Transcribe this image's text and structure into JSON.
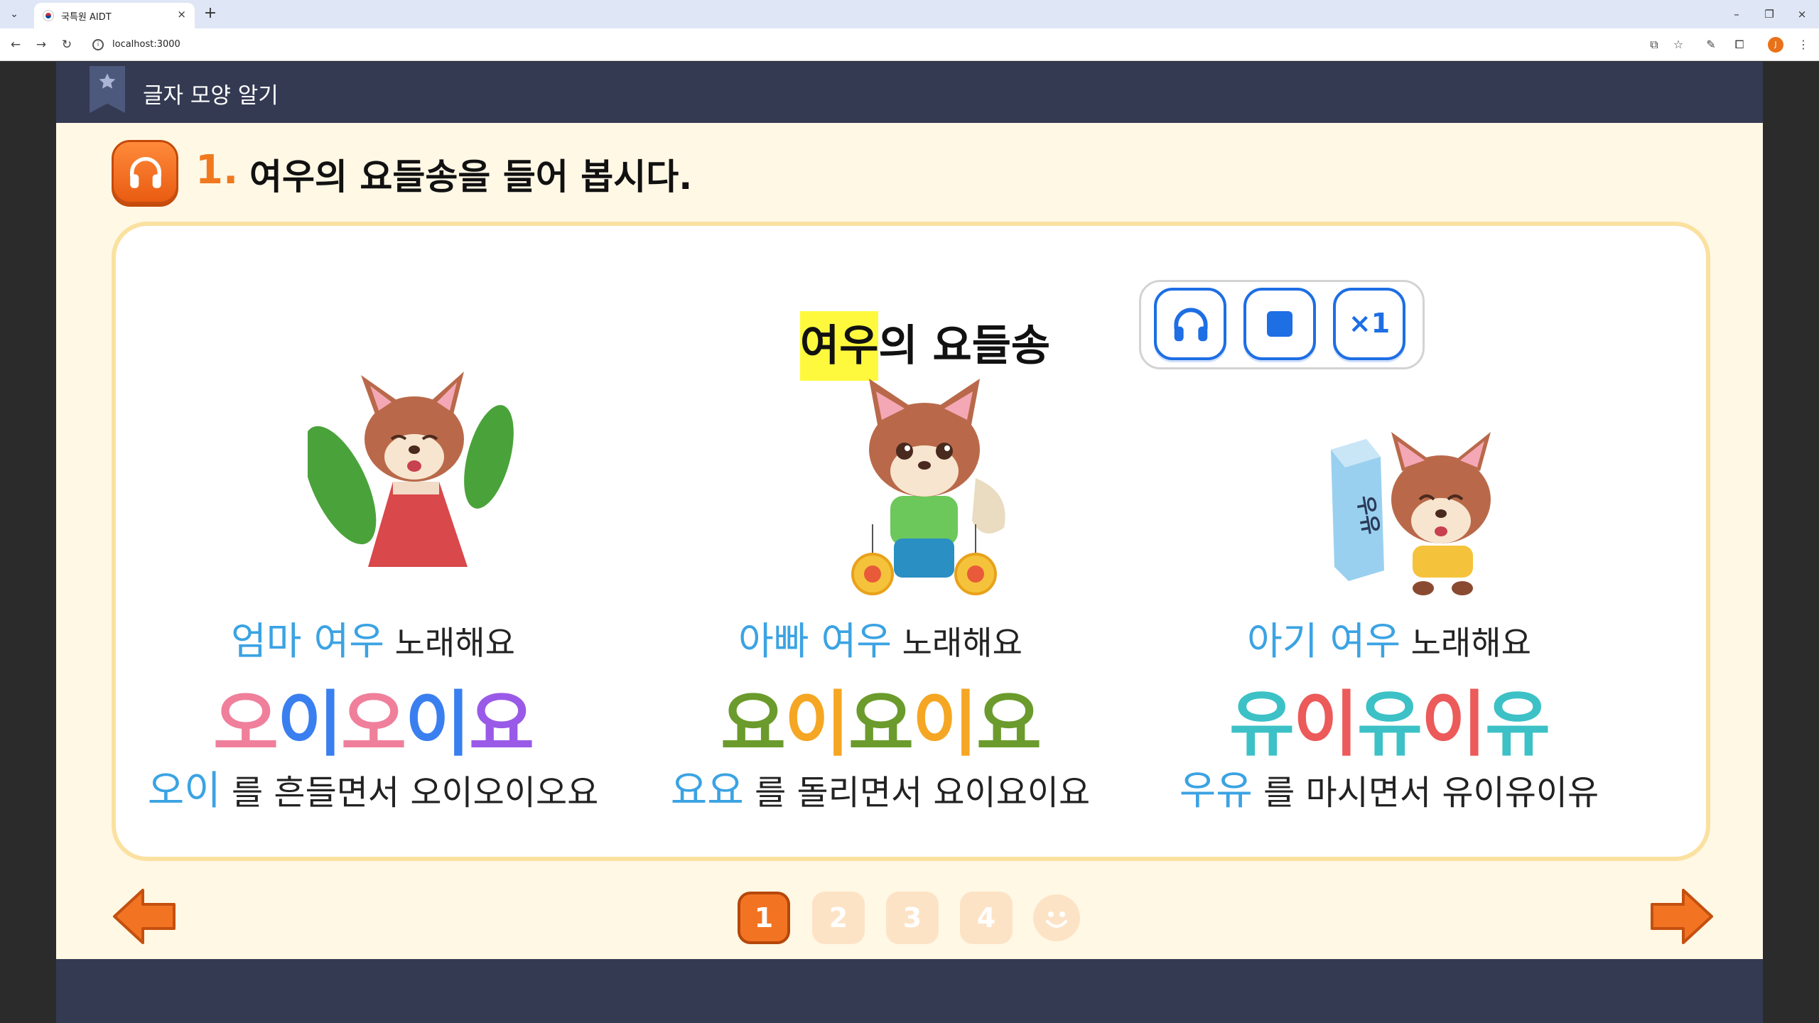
{
  "browser": {
    "tab_title": "국특원 AIDT",
    "tab_close": "×",
    "new_tab": "+",
    "url": "localhost:3000",
    "profile_initial": "J",
    "window_controls": [
      "–",
      "❐",
      "×"
    ]
  },
  "app": {
    "header_title": "글자 모양 알기",
    "question_number": "1.",
    "question_text": "여우의 요들송을 들어 봅시다.",
    "song_title_highlight": "여우",
    "song_title_rest": "의 요들송",
    "controls": {
      "listen_icon": "headphones-icon",
      "stop_icon": "stop-icon",
      "speed_label": "×1"
    },
    "verses": [
      {
        "who": "엄마 여우",
        "sings": " 노래해요",
        "yodel": [
          {
            "text": "오",
            "color": "#ef7f9b"
          },
          {
            "text": "이",
            "color": "#3a7ff0"
          },
          {
            "text": "오",
            "color": "#ef7f9b"
          },
          {
            "text": "이",
            "color": "#3a7ff0"
          },
          {
            "text": "요",
            "color": "#9a5ae8"
          }
        ],
        "key": "오이",
        "line": " 를 흔들면서 오이오이오요"
      },
      {
        "who": "아빠 여우",
        "sings": " 노래해요",
        "yodel": [
          {
            "text": "요",
            "color": "#6b9b2c"
          },
          {
            "text": "이",
            "color": "#f5a623"
          },
          {
            "text": "요",
            "color": "#6b9b2c"
          },
          {
            "text": "이",
            "color": "#f5a623"
          },
          {
            "text": "요",
            "color": "#6b9b2c"
          }
        ],
        "key": "요요",
        "line": " 를 돌리면서 요이요이요"
      },
      {
        "who": "아기 여우",
        "sings": " 노래해요",
        "yodel": [
          {
            "text": "유",
            "color": "#3cc1c6"
          },
          {
            "text": "이",
            "color": "#ec5a5a"
          },
          {
            "text": "유",
            "color": "#3cc1c6"
          },
          {
            "text": "이",
            "color": "#ec5a5a"
          },
          {
            "text": "유",
            "color": "#3cc1c6"
          }
        ],
        "key": "우유",
        "line": " 를 마시면서 유이유이유"
      }
    ],
    "milk_label": "우유",
    "pages": [
      "1",
      "2",
      "3",
      "4"
    ],
    "active_page": "1",
    "accent_color": "#f27423",
    "panel_border_color": "#fbe1a0"
  }
}
